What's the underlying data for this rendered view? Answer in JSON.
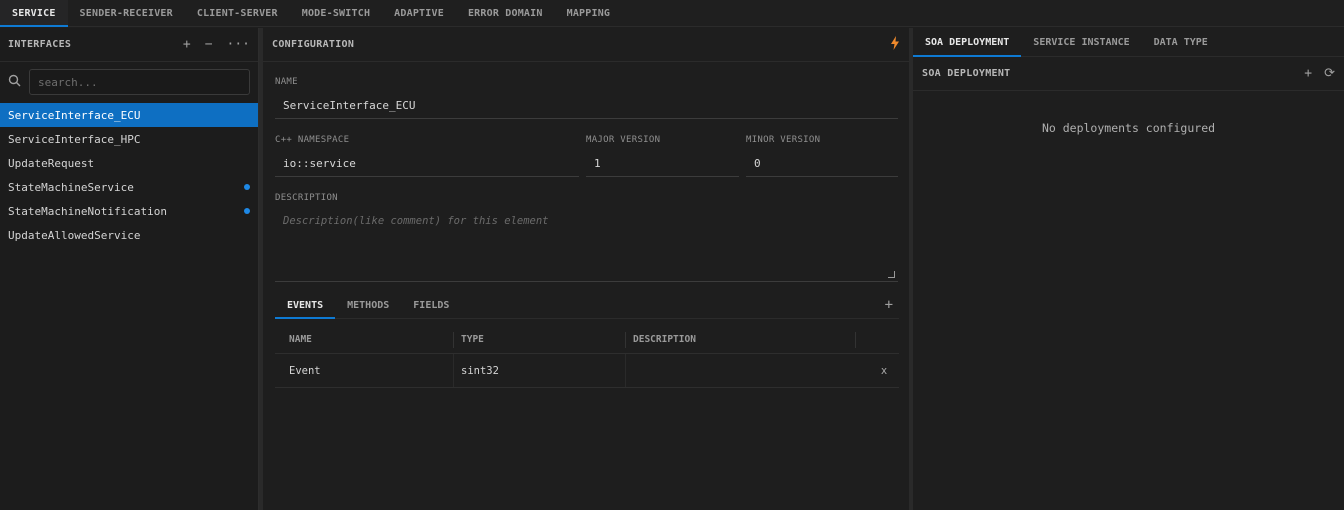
{
  "top_tabs": [
    {
      "label": "SERVICE"
    },
    {
      "label": "SENDER-RECEIVER"
    },
    {
      "label": "CLIENT-SERVER"
    },
    {
      "label": "MODE-SWITCH"
    },
    {
      "label": "ADAPTIVE"
    },
    {
      "label": "ERROR DOMAIN"
    },
    {
      "label": "MAPPING"
    }
  ],
  "sidebar": {
    "title": "INTERFACES",
    "add_icon": "+",
    "remove_icon": "−",
    "more_icon": "···",
    "search_placeholder": "search...",
    "items": [
      {
        "label": "ServiceInterface_ECU"
      },
      {
        "label": "ServiceInterface_HPC"
      },
      {
        "label": "UpdateRequest"
      },
      {
        "label": "StateMachineService"
      },
      {
        "label": "StateMachineNotification"
      },
      {
        "label": "UpdateAllowedService"
      }
    ]
  },
  "config": {
    "title": "CONFIGURATION",
    "name_label": "NAME",
    "name_value": "ServiceInterface_ECU",
    "namespace_label": "C++ NAMESPACE",
    "namespace_value": "io::service",
    "major_label": "MAJOR VERSION",
    "major_value": "1",
    "minor_label": "MINOR VERSION",
    "minor_value": "0",
    "description_label": "DESCRIPTION",
    "description_placeholder": "Description(like comment) for this element",
    "tabs": [
      {
        "label": "EVENTS"
      },
      {
        "label": "METHODS"
      },
      {
        "label": "FIELDS"
      }
    ],
    "add_label": "+",
    "table": {
      "headers": [
        "NAME",
        "TYPE",
        "DESCRIPTION"
      ],
      "rows": [
        {
          "name": "Event",
          "type": "sint32",
          "description": "",
          "remove": "x"
        }
      ]
    }
  },
  "right": {
    "tabs": [
      {
        "label": "SOA DEPLOYMENT"
      },
      {
        "label": "SERVICE INSTANCE"
      },
      {
        "label": "DATA TYPE"
      }
    ],
    "section_title": "SOA DEPLOYMENT",
    "add_icon": "+",
    "refresh_icon": "⟳",
    "empty_message": "No deployments configured"
  },
  "colors": {
    "accent": "#0e7ad3",
    "selected_bg": "#0e6fc2",
    "bolt": "#f08a2c",
    "dot": "#1e88e5"
  }
}
